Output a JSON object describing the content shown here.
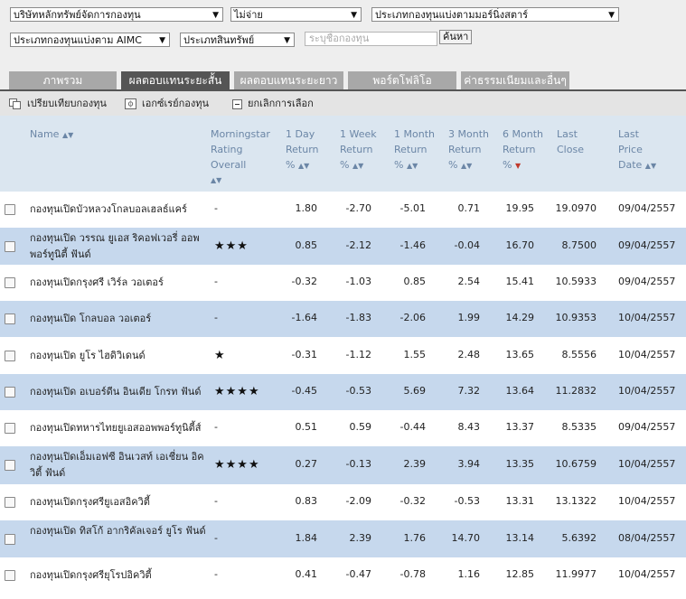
{
  "filters": {
    "company": "บริษัทหลักทรัพย์จัดการกองทุน",
    "dividend": "ไม่จ่าย",
    "morningstar_type": "ประเภทกองทุนแบ่งตามมอร์นิ่งสตาร์",
    "aimc_type": "ประเภทกองทุนแบ่งตาม AIMC",
    "asset_type": "ประเภทสินทรัพย์",
    "search_placeholder": "ระบุชื่อกองทุน",
    "search_button": "ค้นหา"
  },
  "tabs": [
    {
      "label": "ภาพรวม",
      "active": false
    },
    {
      "label": "ผลตอบแทนระยะสั้น",
      "active": true
    },
    {
      "label": "ผลตอบแทนระยะยาว",
      "active": false
    },
    {
      "label": "พอร์ตโฟลิโอ",
      "active": false
    },
    {
      "label": "ค่าธรรมเนียมและอื่นๆ",
      "active": false
    }
  ],
  "toolbar": {
    "compare": "เปรียบเทียบกองทุน",
    "export": "เอกซ์เรย์กองทุน",
    "clear": "ยกเลิกการเลือก"
  },
  "columns": {
    "name": "Name",
    "rating": [
      "Morningstar",
      "Rating",
      "Overall"
    ],
    "d1": [
      "1 Day",
      "Return",
      "%"
    ],
    "w1": [
      "1 Week",
      "Return",
      "%"
    ],
    "m1": [
      "1 Month",
      "Return",
      "%"
    ],
    "m3": [
      "3 Month",
      "Return",
      "%"
    ],
    "m6": [
      "6 Month",
      "Return",
      "%"
    ],
    "close": [
      "Last",
      "Close"
    ],
    "date": [
      "Last",
      "Price",
      "Date"
    ]
  },
  "rows": [
    {
      "name": "กองทุนเปิดบัวหลวงโกลบอลเฮลธ์แคร์",
      "rating": "-",
      "d1": "1.80",
      "w1": "-2.70",
      "m1": "-5.01",
      "m3": "0.71",
      "m6": "19.95",
      "close": "19.0970",
      "date": "09/04/2557"
    },
    {
      "name": "กองทุนเปิด วรรณ ยูเอส ริคอฟเวอรี่ ออพพอร์ทูนิตี้ ฟันด์",
      "rating": "★★★",
      "d1": "0.85",
      "w1": "-2.12",
      "m1": "-1.46",
      "m3": "-0.04",
      "m6": "16.70",
      "close": "8.7500",
      "date": "09/04/2557"
    },
    {
      "name": "กองทุนเปิดกรุงศรี เวิร์ล วอเตอร์",
      "rating": "-",
      "d1": "-0.32",
      "w1": "-1.03",
      "m1": "0.85",
      "m3": "2.54",
      "m6": "15.41",
      "close": "10.5933",
      "date": "09/04/2557"
    },
    {
      "name": "กองทุนเปิด โกลบอล วอเตอร์",
      "rating": "-",
      "d1": "-1.64",
      "w1": "-1.83",
      "m1": "-2.06",
      "m3": "1.99",
      "m6": "14.29",
      "close": "10.9353",
      "date": "10/04/2557"
    },
    {
      "name": "กองทุนเปิด ยูโร ไฮดิวิเดนด์",
      "rating": "★",
      "d1": "-0.31",
      "w1": "-1.12",
      "m1": "1.55",
      "m3": "2.48",
      "m6": "13.65",
      "close": "8.5556",
      "date": "10/04/2557"
    },
    {
      "name": "กองทุนเปิด อเบอร์ดีน อินเดีย โกรท ฟันด์",
      "rating": "★★★★",
      "d1": "-0.45",
      "w1": "-0.53",
      "m1": "5.69",
      "m3": "7.32",
      "m6": "13.64",
      "close": "11.2832",
      "date": "10/04/2557"
    },
    {
      "name": "กองทุนเปิดทหารไทยยูเอสออพพอร์ทูนิตี้ส์",
      "rating": "-",
      "d1": "0.51",
      "w1": "0.59",
      "m1": "-0.44",
      "m3": "8.43",
      "m6": "13.37",
      "close": "8.5335",
      "date": "09/04/2557"
    },
    {
      "name": "กองทุนเปิดเอ็มเอฟซี อินเวสท์ เอเชี่ยน อิควิตี้ ฟันด์",
      "rating": "★★★★",
      "d1": "0.27",
      "w1": "-0.13",
      "m1": "2.39",
      "m3": "3.94",
      "m6": "13.35",
      "close": "10.6759",
      "date": "10/04/2557"
    },
    {
      "name": "กองทุนเปิดกรุงศรียูเอสอิควิตี้",
      "rating": "-",
      "d1": "0.83",
      "w1": "-2.09",
      "m1": "-0.32",
      "m3": "-0.53",
      "m6": "13.31",
      "close": "13.1322",
      "date": "10/04/2557"
    },
    {
      "name": "กองทุนเปิด ทิสโก้ อากริคัลเจอร์ ยูโร ฟันด์",
      "rating": "-",
      "d1": "1.84",
      "w1": "2.39",
      "m1": "1.76",
      "m3": "14.70",
      "m6": "13.14",
      "close": "5.6392",
      "date": "08/04/2557"
    },
    {
      "name": "กองทุนเปิดกรุงศรียุโรปอิควิตี้",
      "rating": "-",
      "d1": "0.41",
      "w1": "-0.47",
      "m1": "-0.78",
      "m3": "1.16",
      "m6": "12.85",
      "close": "11.9977",
      "date": "10/04/2557"
    }
  ]
}
